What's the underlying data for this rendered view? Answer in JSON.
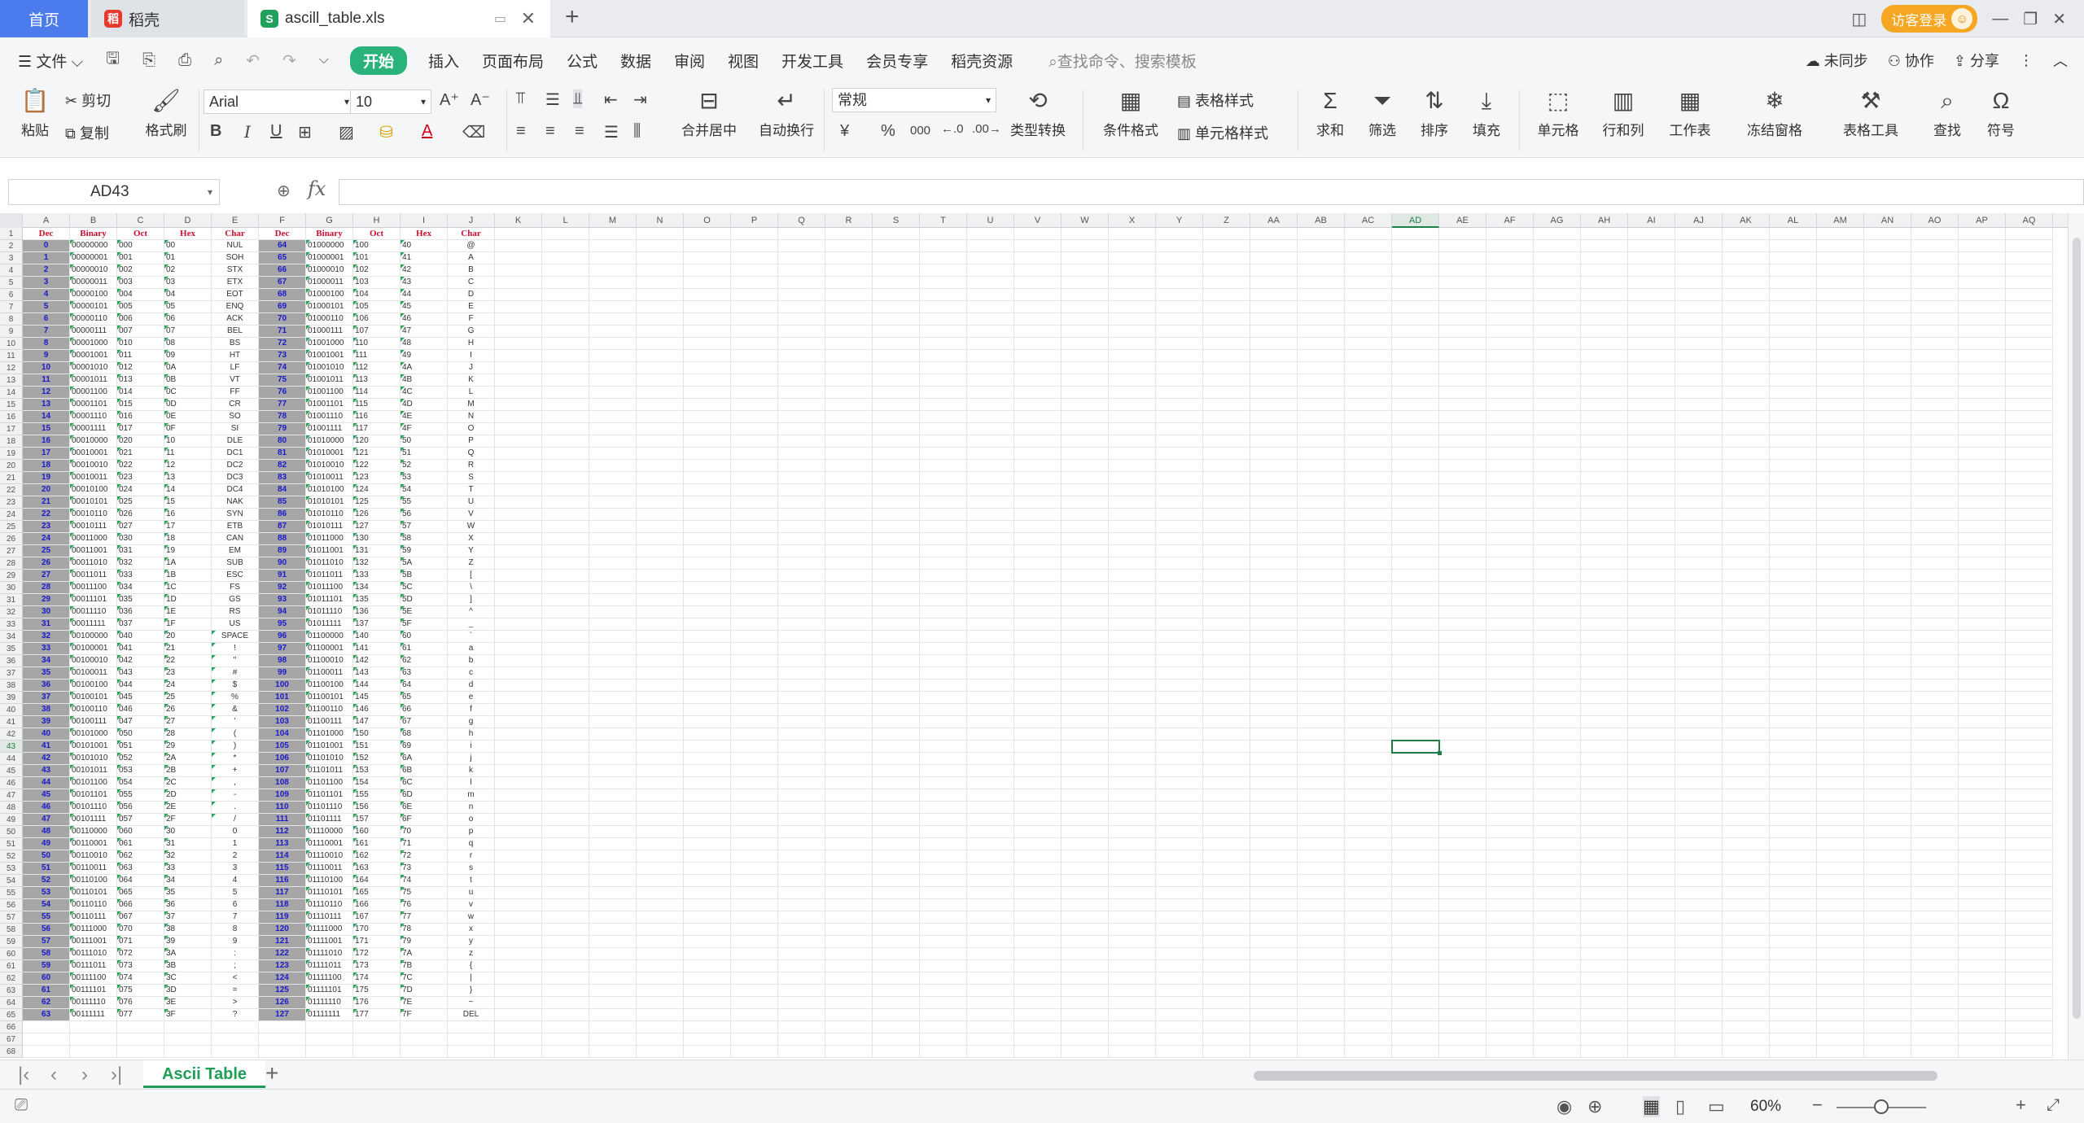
{
  "tabs": {
    "home": "首页",
    "docer": "稻壳",
    "file": "ascill_table.xls",
    "new_tab": "+"
  },
  "window": {
    "login": "访客登录"
  },
  "menu": {
    "file": "文件",
    "items": [
      "开始",
      "插入",
      "页面布局",
      "公式",
      "数据",
      "审阅",
      "视图",
      "开发工具",
      "会员专享",
      "稻壳资源"
    ],
    "search": "查找命令、搜索模板",
    "sync": "未同步",
    "collab": "协作",
    "share": "分享"
  },
  "ribbon": {
    "paste": "粘贴",
    "cut": "剪切",
    "copy": "复制",
    "format_painter": "格式刷",
    "font_name": "Arial",
    "font_size": "10",
    "merge": "合并居中",
    "wrap": "自动换行",
    "number_format": "常规",
    "type_convert": "类型转换",
    "cond_format": "条件格式",
    "table_style": "表格样式",
    "cell_style": "单元格样式",
    "sum": "求和",
    "filter": "筛选",
    "sort": "排序",
    "fill": "填充",
    "cell": "单元格",
    "rowcol": "行和列",
    "worksheet": "工作表",
    "freeze": "冻结窗格",
    "table_tools": "表格工具",
    "find": "查找",
    "symbol": "符号",
    "currency": "¥",
    "percent": "%",
    "thousands": "000"
  },
  "formula_bar": {
    "name_box": "AD43",
    "fx": "fx"
  },
  "sheet": {
    "columns": [
      "A",
      "B",
      "C",
      "D",
      "E",
      "F",
      "G",
      "H",
      "I",
      "J",
      "K",
      "L",
      "M",
      "N",
      "O",
      "P",
      "Q",
      "R",
      "S",
      "T",
      "U",
      "V",
      "W",
      "X",
      "Y",
      "Z",
      "AA",
      "AB",
      "AC",
      "AD",
      "AE",
      "AF",
      "AG",
      "AH",
      "AI",
      "AJ",
      "AK",
      "AL",
      "AM",
      "AN",
      "AO",
      "AP",
      "AQ"
    ],
    "selected_column": "AD",
    "selected_row": 43,
    "visible_rows": 68,
    "headers": [
      "Dec",
      "Binary",
      "Oct",
      "Hex",
      "Char",
      "Dec",
      "Binary",
      "Oct",
      "Hex",
      "Char"
    ],
    "rows": [
      [
        "0",
        "00000000",
        "000",
        "00",
        "NUL",
        "64",
        "01000000",
        "100",
        "40",
        "@"
      ],
      [
        "1",
        "00000001",
        "001",
        "01",
        "SOH",
        "65",
        "01000001",
        "101",
        "41",
        "A"
      ],
      [
        "2",
        "00000010",
        "002",
        "02",
        "STX",
        "66",
        "01000010",
        "102",
        "42",
        "B"
      ],
      [
        "3",
        "00000011",
        "003",
        "03",
        "ETX",
        "67",
        "01000011",
        "103",
        "43",
        "C"
      ],
      [
        "4",
        "00000100",
        "004",
        "04",
        "EOT",
        "68",
        "01000100",
        "104",
        "44",
        "D"
      ],
      [
        "5",
        "00000101",
        "005",
        "05",
        "ENQ",
        "69",
        "01000101",
        "105",
        "45",
        "E"
      ],
      [
        "6",
        "00000110",
        "006",
        "06",
        "ACK",
        "70",
        "01000110",
        "106",
        "46",
        "F"
      ],
      [
        "7",
        "00000111",
        "007",
        "07",
        "BEL",
        "71",
        "01000111",
        "107",
        "47",
        "G"
      ],
      [
        "8",
        "00001000",
        "010",
        "08",
        "BS",
        "72",
        "01001000",
        "110",
        "48",
        "H"
      ],
      [
        "9",
        "00001001",
        "011",
        "09",
        "HT",
        "73",
        "01001001",
        "111",
        "49",
        "I"
      ],
      [
        "10",
        "00001010",
        "012",
        "0A",
        "LF",
        "74",
        "01001010",
        "112",
        "4A",
        "J"
      ],
      [
        "11",
        "00001011",
        "013",
        "0B",
        "VT",
        "75",
        "01001011",
        "113",
        "4B",
        "K"
      ],
      [
        "12",
        "00001100",
        "014",
        "0C",
        "FF",
        "76",
        "01001100",
        "114",
        "4C",
        "L"
      ],
      [
        "13",
        "00001101",
        "015",
        "0D",
        "CR",
        "77",
        "01001101",
        "115",
        "4D",
        "M"
      ],
      [
        "14",
        "00001110",
        "016",
        "0E",
        "SO",
        "78",
        "01001110",
        "116",
        "4E",
        "N"
      ],
      [
        "15",
        "00001111",
        "017",
        "0F",
        "SI",
        "79",
        "01001111",
        "117",
        "4F",
        "O"
      ],
      [
        "16",
        "00010000",
        "020",
        "10",
        "DLE",
        "80",
        "01010000",
        "120",
        "50",
        "P"
      ],
      [
        "17",
        "00010001",
        "021",
        "11",
        "DC1",
        "81",
        "01010001",
        "121",
        "51",
        "Q"
      ],
      [
        "18",
        "00010010",
        "022",
        "12",
        "DC2",
        "82",
        "01010010",
        "122",
        "52",
        "R"
      ],
      [
        "19",
        "00010011",
        "023",
        "13",
        "DC3",
        "83",
        "01010011",
        "123",
        "53",
        "S"
      ],
      [
        "20",
        "00010100",
        "024",
        "14",
        "DC4",
        "84",
        "01010100",
        "124",
        "54",
        "T"
      ],
      [
        "21",
        "00010101",
        "025",
        "15",
        "NAK",
        "85",
        "01010101",
        "125",
        "55",
        "U"
      ],
      [
        "22",
        "00010110",
        "026",
        "16",
        "SYN",
        "86",
        "01010110",
        "126",
        "56",
        "V"
      ],
      [
        "23",
        "00010111",
        "027",
        "17",
        "ETB",
        "87",
        "01010111",
        "127",
        "57",
        "W"
      ],
      [
        "24",
        "00011000",
        "030",
        "18",
        "CAN",
        "88",
        "01011000",
        "130",
        "58",
        "X"
      ],
      [
        "25",
        "00011001",
        "031",
        "19",
        "EM",
        "89",
        "01011001",
        "131",
        "59",
        "Y"
      ],
      [
        "26",
        "00011010",
        "032",
        "1A",
        "SUB",
        "90",
        "01011010",
        "132",
        "5A",
        "Z"
      ],
      [
        "27",
        "00011011",
        "033",
        "1B",
        "ESC",
        "91",
        "01011011",
        "133",
        "5B",
        "["
      ],
      [
        "28",
        "00011100",
        "034",
        "1C",
        "FS",
        "92",
        "01011100",
        "134",
        "5C",
        "\\"
      ],
      [
        "29",
        "00011101",
        "035",
        "1D",
        "GS",
        "93",
        "01011101",
        "135",
        "5D",
        "]"
      ],
      [
        "30",
        "00011110",
        "036",
        "1E",
        "RS",
        "94",
        "01011110",
        "136",
        "5E",
        "^"
      ],
      [
        "31",
        "00011111",
        "037",
        "1F",
        "US",
        "95",
        "01011111",
        "137",
        "5F",
        "_"
      ],
      [
        "32",
        "00100000",
        "040",
        "20",
        "SPACE",
        "96",
        "01100000",
        "140",
        "60",
        "`"
      ],
      [
        "33",
        "00100001",
        "041",
        "21",
        "!",
        "97",
        "01100001",
        "141",
        "61",
        "a"
      ],
      [
        "34",
        "00100010",
        "042",
        "22",
        "\"",
        "98",
        "01100010",
        "142",
        "62",
        "b"
      ],
      [
        "35",
        "00100011",
        "043",
        "23",
        "#",
        "99",
        "01100011",
        "143",
        "63",
        "c"
      ],
      [
        "36",
        "00100100",
        "044",
        "24",
        "$",
        "100",
        "01100100",
        "144",
        "64",
        "d"
      ],
      [
        "37",
        "00100101",
        "045",
        "25",
        "%",
        "101",
        "01100101",
        "145",
        "65",
        "e"
      ],
      [
        "38",
        "00100110",
        "046",
        "26",
        "&",
        "102",
        "01100110",
        "146",
        "66",
        "f"
      ],
      [
        "39",
        "00100111",
        "047",
        "27",
        "'",
        "103",
        "01100111",
        "147",
        "67",
        "g"
      ],
      [
        "40",
        "00101000",
        "050",
        "28",
        "(",
        "104",
        "01101000",
        "150",
        "68",
        "h"
      ],
      [
        "41",
        "00101001",
        "051",
        "29",
        ")",
        "105",
        "01101001",
        "151",
        "69",
        "i"
      ],
      [
        "42",
        "00101010",
        "052",
        "2A",
        "*",
        "106",
        "01101010",
        "152",
        "6A",
        "j"
      ],
      [
        "43",
        "00101011",
        "053",
        "2B",
        "+",
        "107",
        "01101011",
        "153",
        "6B",
        "k"
      ],
      [
        "44",
        "00101100",
        "054",
        "2C",
        ",",
        "108",
        "01101100",
        "154",
        "6C",
        "l"
      ],
      [
        "45",
        "00101101",
        "055",
        "2D",
        "-",
        "109",
        "01101101",
        "155",
        "6D",
        "m"
      ],
      [
        "46",
        "00101110",
        "056",
        "2E",
        ".",
        "110",
        "01101110",
        "156",
        "6E",
        "n"
      ],
      [
        "47",
        "00101111",
        "057",
        "2F",
        "/",
        "111",
        "01101111",
        "157",
        "6F",
        "o"
      ],
      [
        "48",
        "00110000",
        "060",
        "30",
        "0",
        "112",
        "01110000",
        "160",
        "70",
        "p"
      ],
      [
        "49",
        "00110001",
        "061",
        "31",
        "1",
        "113",
        "01110001",
        "161",
        "71",
        "q"
      ],
      [
        "50",
        "00110010",
        "062",
        "32",
        "2",
        "114",
        "01110010",
        "162",
        "72",
        "r"
      ],
      [
        "51",
        "00110011",
        "063",
        "33",
        "3",
        "115",
        "01110011",
        "163",
        "73",
        "s"
      ],
      [
        "52",
        "00110100",
        "064",
        "34",
        "4",
        "116",
        "01110100",
        "164",
        "74",
        "t"
      ],
      [
        "53",
        "00110101",
        "065",
        "35",
        "5",
        "117",
        "01110101",
        "165",
        "75",
        "u"
      ],
      [
        "54",
        "00110110",
        "066",
        "36",
        "6",
        "118",
        "01110110",
        "166",
        "76",
        "v"
      ],
      [
        "55",
        "00110111",
        "067",
        "37",
        "7",
        "119",
        "01110111",
        "167",
        "77",
        "w"
      ],
      [
        "56",
        "00111000",
        "070",
        "38",
        "8",
        "120",
        "01111000",
        "170",
        "78",
        "x"
      ],
      [
        "57",
        "00111001",
        "071",
        "39",
        "9",
        "121",
        "01111001",
        "171",
        "79",
        "y"
      ],
      [
        "58",
        "00111010",
        "072",
        "3A",
        ":",
        "122",
        "01111010",
        "172",
        "7A",
        "z"
      ],
      [
        "59",
        "00111011",
        "073",
        "3B",
        ";",
        "123",
        "01111011",
        "173",
        "7B",
        "{"
      ],
      [
        "60",
        "00111100",
        "074",
        "3C",
        "<",
        "124",
        "01111100",
        "174",
        "7C",
        "|"
      ],
      [
        "61",
        "00111101",
        "075",
        "3D",
        "=",
        "125",
        "01111101",
        "175",
        "7D",
        "}"
      ],
      [
        "62",
        "00111110",
        "076",
        "3E",
        ">",
        "126",
        "01111110",
        "176",
        "7E",
        "~"
      ],
      [
        "63",
        "00111111",
        "077",
        "3F",
        "?",
        "127",
        "01111111",
        "177",
        "7F",
        "DEL"
      ]
    ]
  },
  "sheet_tabs": {
    "active": "Ascii Table"
  },
  "status": {
    "zoom": "60%"
  },
  "colors": {
    "accent": "#1f9e55",
    "start_button": "#2ab27b",
    "home_tab": "#4b7bec",
    "header_text": "#c8102e",
    "dec_bg": "#a6a6a6",
    "dec_text": "#1a1acc"
  }
}
